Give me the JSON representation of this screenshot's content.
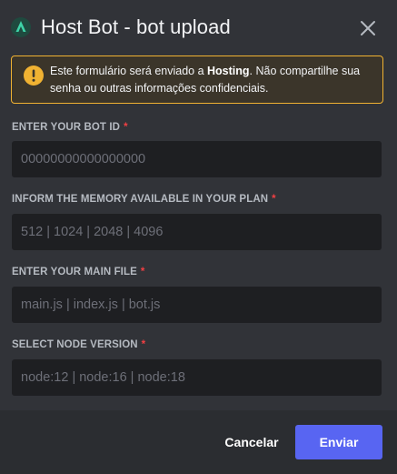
{
  "header": {
    "title": "Host Bot - bot upload",
    "app_icon": "app-logo-icon",
    "close_icon": "close-icon"
  },
  "notice": {
    "icon": "warning-icon",
    "text_before": "Este formulário será enviado a ",
    "text_bold": "Hosting",
    "text_after": ". Não compartilhe sua senha ou outras informações confidenciais."
  },
  "fields": [
    {
      "label": "ENTER YOUR BOT ID",
      "required": "*",
      "placeholder": "00000000000000000"
    },
    {
      "label": "INFORM THE MEMORY AVAILABLE IN YOUR PLAN",
      "required": "*",
      "placeholder": "512 | 1024 | 2048 | 4096"
    },
    {
      "label": "ENTER YOUR MAIN FILE",
      "required": "*",
      "placeholder": "main.js | index.js | bot.js"
    },
    {
      "label": "SELECT NODE VERSION",
      "required": "*",
      "placeholder": "node:12 | node:16 | node:18"
    }
  ],
  "footer": {
    "cancel_label": "Cancelar",
    "submit_label": "Enviar"
  },
  "colors": {
    "background": "#313338",
    "footer_background": "#2b2d31",
    "input_background": "#1e1f22",
    "warning": "#f0b232",
    "required": "#f23f43",
    "accent": "#5865f2"
  }
}
